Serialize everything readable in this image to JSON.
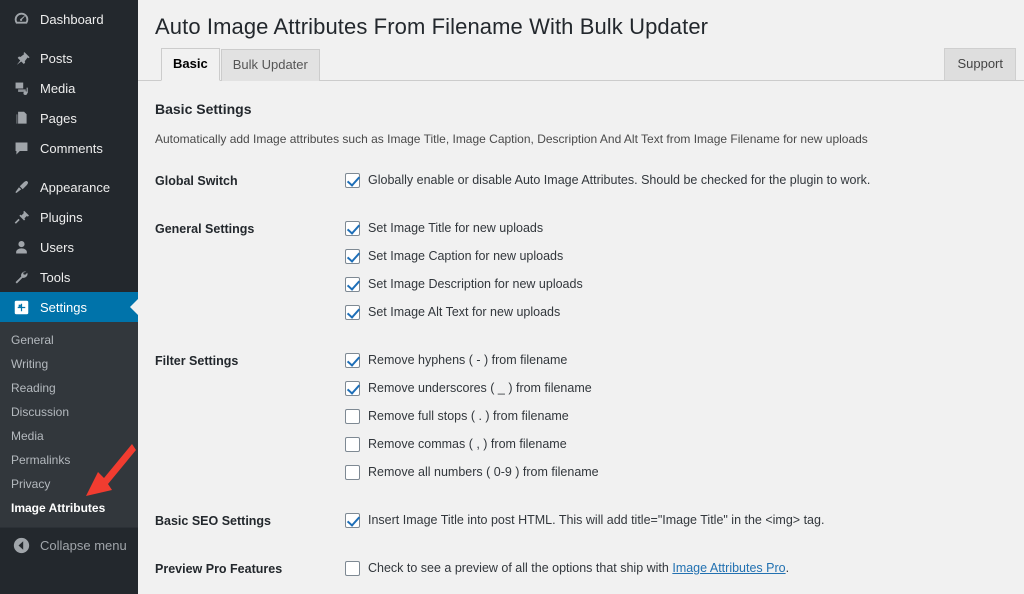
{
  "sidebar": {
    "items": [
      {
        "label": "Dashboard",
        "icon": "dashboard-icon",
        "active": false,
        "gap_after": true
      },
      {
        "label": "Posts",
        "icon": "pin-icon",
        "active": false,
        "gap_after": false
      },
      {
        "label": "Media",
        "icon": "media-icon",
        "active": false,
        "gap_after": false
      },
      {
        "label": "Pages",
        "icon": "pages-icon",
        "active": false,
        "gap_after": false
      },
      {
        "label": "Comments",
        "icon": "comment-icon",
        "active": false,
        "gap_after": true
      },
      {
        "label": "Appearance",
        "icon": "paintbrush-icon",
        "active": false,
        "gap_after": false
      },
      {
        "label": "Plugins",
        "icon": "plug-icon",
        "active": false,
        "gap_after": false
      },
      {
        "label": "Users",
        "icon": "user-icon",
        "active": false,
        "gap_after": false
      },
      {
        "label": "Tools",
        "icon": "wrench-icon",
        "active": false,
        "gap_after": false
      },
      {
        "label": "Settings",
        "icon": "settings-icon",
        "active": true,
        "gap_after": false
      }
    ],
    "submenu": [
      {
        "label": "General",
        "current": false
      },
      {
        "label": "Writing",
        "current": false
      },
      {
        "label": "Reading",
        "current": false
      },
      {
        "label": "Discussion",
        "current": false
      },
      {
        "label": "Media",
        "current": false
      },
      {
        "label": "Permalinks",
        "current": false
      },
      {
        "label": "Privacy",
        "current": false
      },
      {
        "label": "Image Attributes",
        "current": true
      }
    ],
    "collapse_label": "Collapse menu",
    "collapse_icon": "collapse-arrow-icon",
    "colors": {
      "background": "#23282d",
      "submenu_background": "#32373c",
      "active": "#0073aa",
      "text": "#eeeeee"
    }
  },
  "annotation": {
    "type": "arrow",
    "color": "#f13c30",
    "points_to": "Image Attributes"
  },
  "header": {
    "title": "Auto Image Attributes From Filename With Bulk Updater"
  },
  "tabs": [
    {
      "label": "Basic",
      "active": true
    },
    {
      "label": "Bulk Updater",
      "active": false
    }
  ],
  "support_button": {
    "label": "Support"
  },
  "settings": {
    "section_title": "Basic Settings",
    "section_description": "Automatically add Image attributes such as Image Title, Image Caption, Description And Alt Text from Image Filename for new uploads",
    "global_switch": {
      "label": "Global Switch",
      "options": [
        {
          "text": "Globally enable or disable Auto Image Attributes. Should be checked for the plugin to work.",
          "checked": true
        }
      ]
    },
    "general_settings": {
      "label": "General Settings",
      "options": [
        {
          "text": "Set Image Title for new uploads",
          "checked": true
        },
        {
          "text": "Set Image Caption for new uploads",
          "checked": true
        },
        {
          "text": "Set Image Description for new uploads",
          "checked": true
        },
        {
          "text": "Set Image Alt Text for new uploads",
          "checked": true
        }
      ]
    },
    "filter_settings": {
      "label": "Filter Settings",
      "options": [
        {
          "text": "Remove hyphens ( - ) from filename",
          "checked": true
        },
        {
          "text": "Remove underscores ( _ ) from filename",
          "checked": true
        },
        {
          "text": "Remove full stops ( . ) from filename",
          "checked": false
        },
        {
          "text": "Remove commas ( , ) from filename",
          "checked": false
        },
        {
          "text": "Remove all numbers ( 0-9 ) from filename",
          "checked": false
        }
      ]
    },
    "basic_seo_settings": {
      "label": "Basic SEO Settings",
      "options": [
        {
          "text": "Insert Image Title into post HTML. This will add title=\"Image Title\" in the <img> tag.",
          "checked": true
        }
      ]
    },
    "preview_pro_features": {
      "label": "Preview Pro Features",
      "checked": false,
      "text_before": "Check to see a preview of all the options that ship with ",
      "link_text": "Image Attributes Pro",
      "text_after": "."
    }
  }
}
